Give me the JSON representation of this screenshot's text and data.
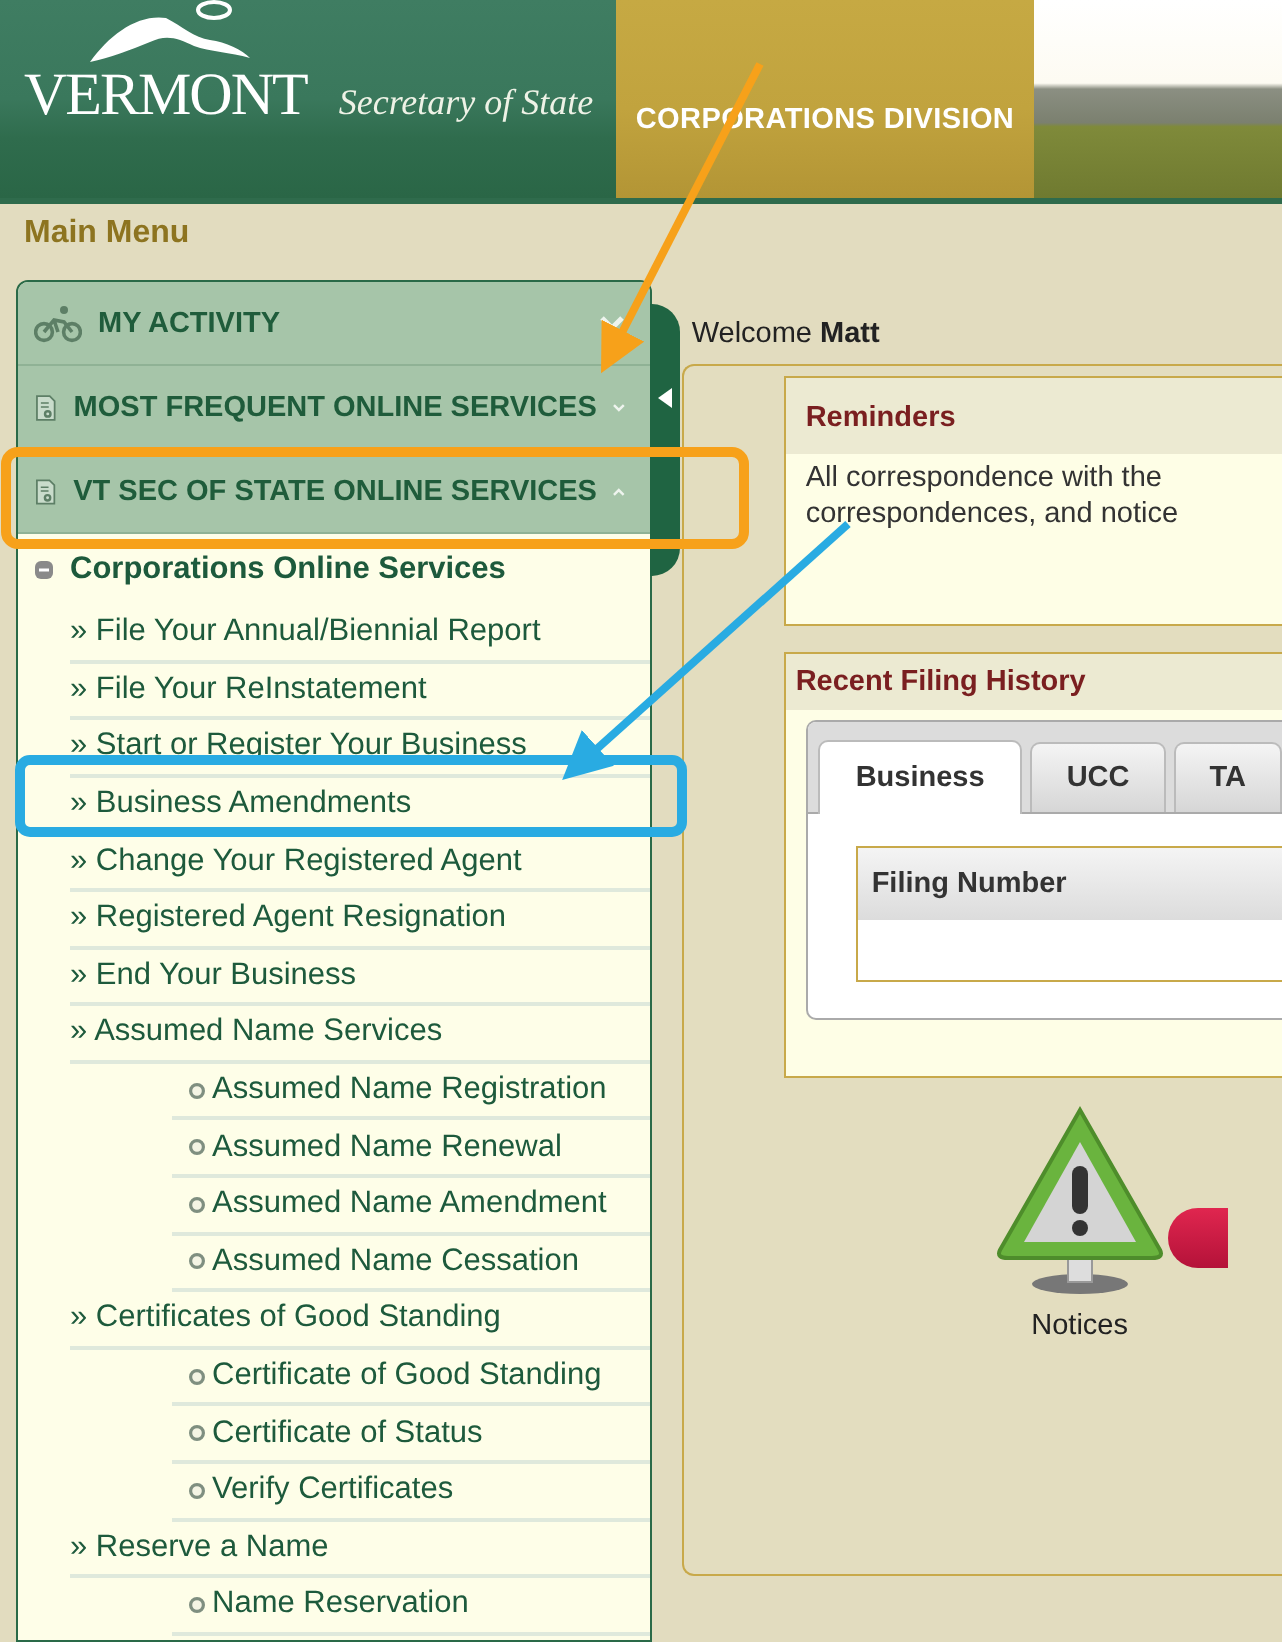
{
  "header": {
    "state": "VERMONT",
    "office": "Secretary of State",
    "division": "CORPORATIONS DIVISION"
  },
  "main_menu": {
    "title": "Main Menu"
  },
  "sidebar": {
    "sections": [
      {
        "label": "MY ACTIVITY",
        "kind": "activity",
        "expanded": false
      },
      {
        "label": "MOST FREQUENT ONLINE SERVICES",
        "kind": "services",
        "expanded": false
      },
      {
        "label": "VT SEC OF STATE ONLINE SERVICES",
        "kind": "services",
        "expanded": true
      }
    ],
    "tree": {
      "label": "Corporations Online Services",
      "expanded": true,
      "children": [
        {
          "label": "» File Your Annual/Biennial Report"
        },
        {
          "label": "» File Your ReInstatement"
        },
        {
          "label": "» Start or Register Your Business"
        },
        {
          "label": "» Business Amendments"
        },
        {
          "label": "» Change Your Registered Agent"
        },
        {
          "label": "» Registered Agent Resignation"
        },
        {
          "label": "» End Your Business"
        },
        {
          "label": "» Assumed Name Services",
          "children": [
            {
              "label": "Assumed Name Registration"
            },
            {
              "label": "Assumed Name Renewal"
            },
            {
              "label": "Assumed Name Amendment"
            },
            {
              "label": "Assumed Name Cessation"
            }
          ]
        },
        {
          "label": "» Certificates of Good Standing",
          "children": [
            {
              "label": "Certificate of Good Standing"
            },
            {
              "label": "Certificate of Status"
            },
            {
              "label": "Verify Certificates"
            }
          ]
        },
        {
          "label": "» Reserve a Name",
          "children": [
            {
              "label": "Name Reservation"
            }
          ]
        }
      ]
    }
  },
  "welcome": "Welcome **Matt**",
  "reminders": {
    "title": "Reminders",
    "lines": [
      "All correspondence with the",
      "correspondences, and notice"
    ]
  },
  "filing_history": {
    "title": "Recent Filing History",
    "tabs": [
      {
        "label": "Business",
        "selected": true
      },
      {
        "label": "UCC",
        "selected": false
      },
      {
        "label": "TA",
        "selected": false
      }
    ],
    "columns": [
      "Filing Number"
    ]
  },
  "notices": {
    "label": "Notices"
  }
}
